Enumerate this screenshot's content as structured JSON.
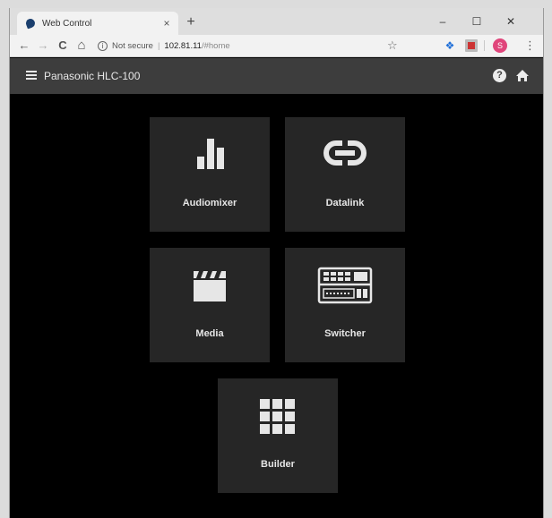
{
  "browser": {
    "tab_title": "Web Control",
    "tab_close": "×",
    "new_tab": "+",
    "minimize": "–",
    "maximize": "☐",
    "close": "✕",
    "back": "←",
    "forward": "→",
    "reload": "C",
    "home": "⌂",
    "info_glyph": "i",
    "security_label": "Not secure",
    "separator": "|",
    "url_host": "102.81.11",
    "url_path": "/#home",
    "bookmark_star": "☆",
    "profile_initial": "S",
    "menu_glyph": "⋮",
    "dropbox_glyph": "❖"
  },
  "app": {
    "title": "Panasonic HLC-100",
    "help_glyph": "?"
  },
  "tiles": [
    {
      "label": "Audiomixer",
      "icon": "bar-chart-icon"
    },
    {
      "label": "Datalink",
      "icon": "link-icon"
    },
    {
      "label": "Media",
      "icon": "clapperboard-icon"
    },
    {
      "label": "Switcher",
      "icon": "switcher-console-icon"
    },
    {
      "label": "Builder",
      "icon": "grid-icon"
    }
  ],
  "colors": {
    "background": "#000000",
    "appbar": "#3d3d3d",
    "tile": "#262626",
    "icon": "#e6e6e6"
  }
}
